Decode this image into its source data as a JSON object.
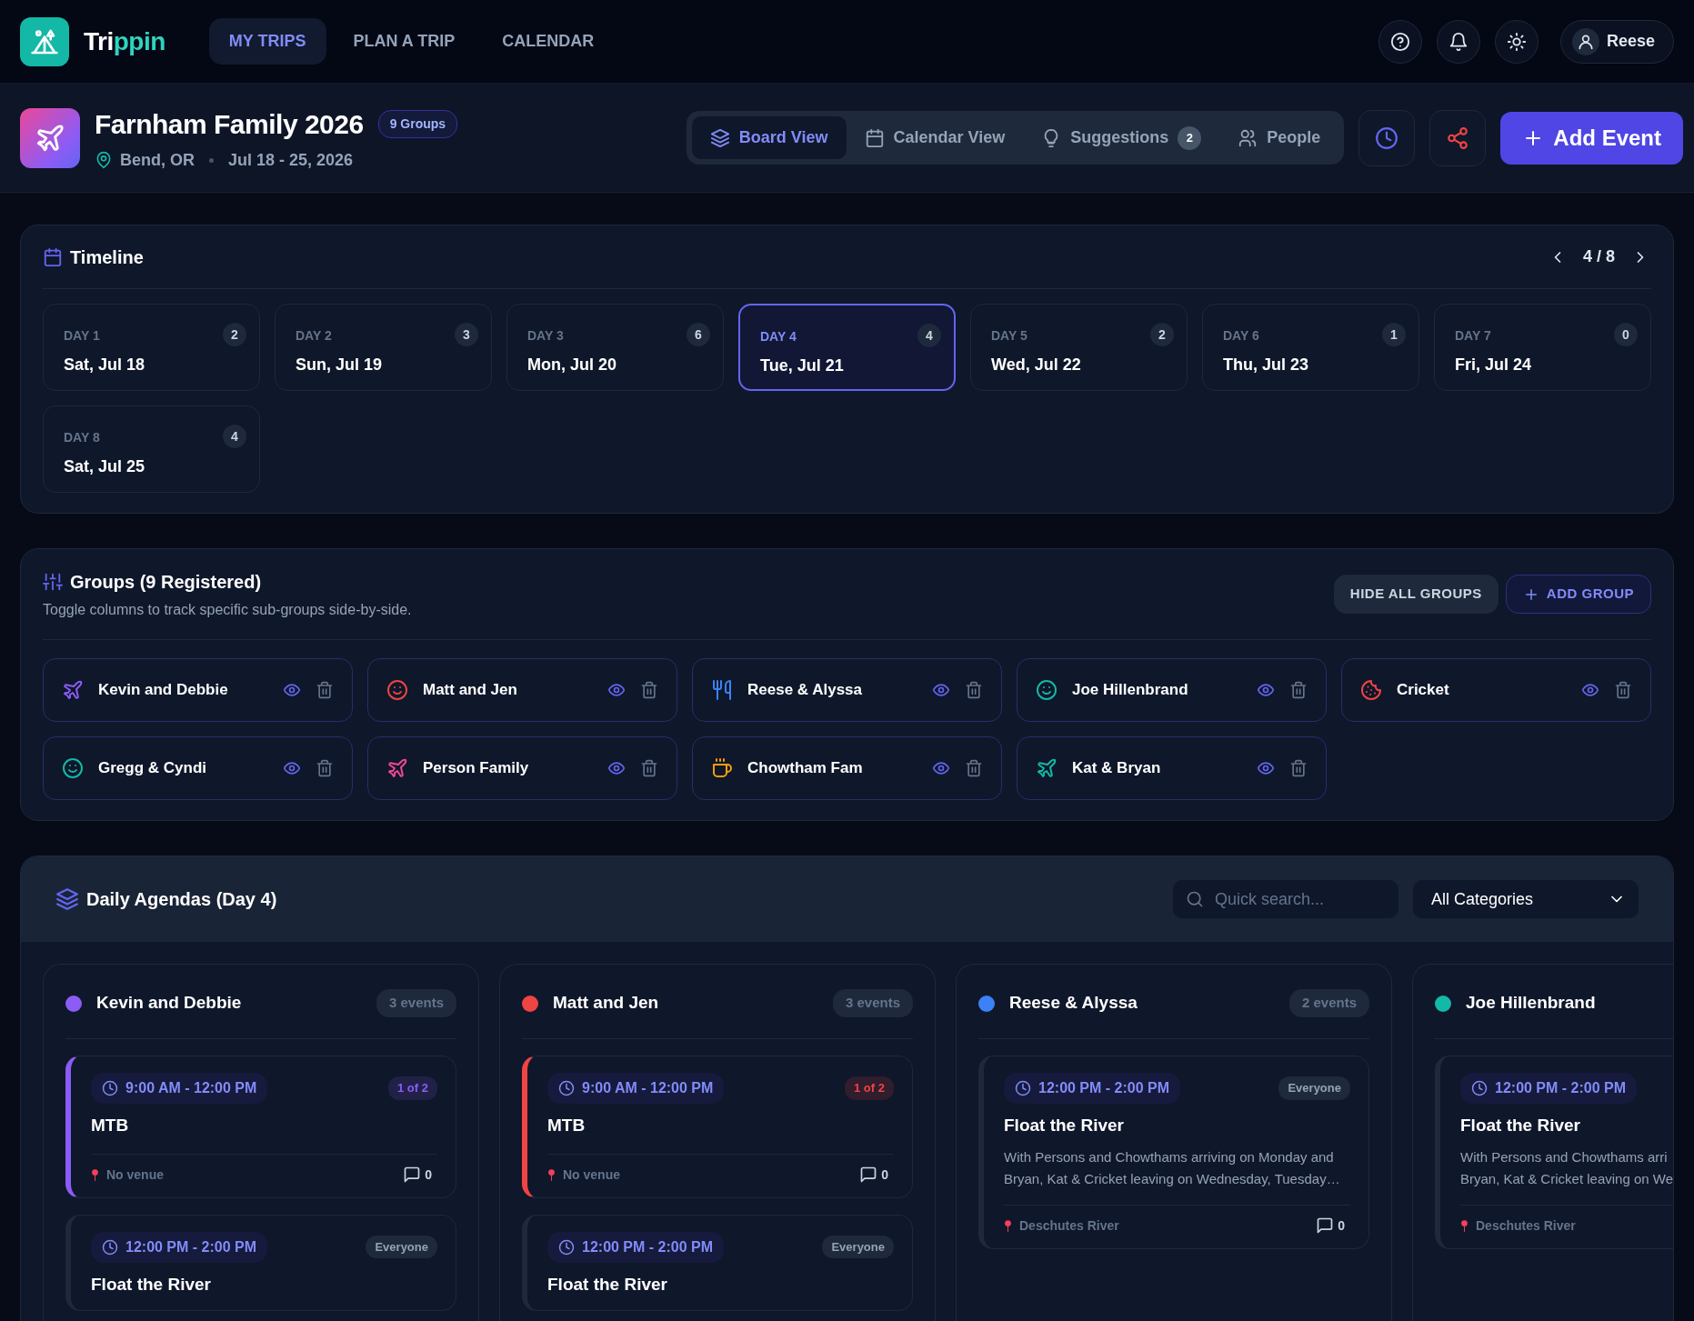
{
  "brand": {
    "lead": "Tri",
    "accent": "ppin"
  },
  "nav": [
    {
      "label": "MY TRIPS",
      "selected": true
    },
    {
      "label": "PLAN A TRIP",
      "selected": false
    },
    {
      "label": "CALENDAR",
      "selected": false
    }
  ],
  "user": {
    "name": "Reese"
  },
  "trip": {
    "title": "Farnham Family 2026",
    "badge": "9 Groups",
    "location": "Bend, OR",
    "dates": "Jul 18 - 25, 2026"
  },
  "view_tabs": [
    {
      "label": "Board View",
      "kind": "layers",
      "selected": true
    },
    {
      "label": "Calendar View",
      "kind": "calendar",
      "selected": false
    },
    {
      "label": "Suggestions",
      "kind": "bulb",
      "count": "2",
      "selected": false
    },
    {
      "label": "People",
      "kind": "people",
      "selected": false
    }
  ],
  "add_event": "Add Event",
  "timeline": {
    "title": "Timeline",
    "pager": "4 / 8",
    "days": [
      {
        "label": "DAY 1",
        "date": "Sat, Jul 18",
        "count": "2",
        "selected": false
      },
      {
        "label": "DAY 2",
        "date": "Sun, Jul 19",
        "count": "3",
        "selected": false
      },
      {
        "label": "DAY 3",
        "date": "Mon, Jul 20",
        "count": "6",
        "selected": false
      },
      {
        "label": "DAY 4",
        "date": "Tue, Jul 21",
        "count": "4",
        "selected": true
      },
      {
        "label": "DAY 5",
        "date": "Wed, Jul 22",
        "count": "2",
        "selected": false
      },
      {
        "label": "DAY 6",
        "date": "Thu, Jul 23",
        "count": "1",
        "selected": false
      },
      {
        "label": "DAY 7",
        "date": "Fri, Jul 24",
        "count": "0",
        "selected": false
      },
      {
        "label": "DAY 8",
        "date": "Sat, Jul 25",
        "count": "4",
        "selected": false
      }
    ]
  },
  "groups": {
    "title": "Groups (9 Registered)",
    "subtitle": "Toggle columns to track specific sub-groups side-by-side.",
    "hide_all": "HIDE ALL GROUPS",
    "add": "ADD GROUP",
    "items": [
      {
        "name": "Kevin and Debbie",
        "kind": "plane",
        "color": "#8b5cf6"
      },
      {
        "name": "Matt and Jen",
        "kind": "smile",
        "color": "#ef4444"
      },
      {
        "name": "Reese & Alyssa",
        "kind": "utensils",
        "color": "#3b82f6"
      },
      {
        "name": "Joe Hillenbrand",
        "kind": "smile",
        "color": "#14b8a6"
      },
      {
        "name": "Cricket",
        "kind": "cookie",
        "color": "#ef4444"
      },
      {
        "name": "Gregg & Cyndi",
        "kind": "smile",
        "color": "#14b8a6"
      },
      {
        "name": "Person Family",
        "kind": "plane",
        "color": "#ec4899"
      },
      {
        "name": "Chowtham Fam",
        "kind": "coffee",
        "color": "#f59e0b"
      },
      {
        "name": "Kat & Bryan",
        "kind": "plane",
        "color": "#14b8a6"
      }
    ]
  },
  "agenda": {
    "title": "Daily Agendas (Day 4)",
    "search": {
      "placeholder": "Quick search..."
    },
    "category": "All Categories",
    "columns": [
      {
        "name": "Kevin and Debbie",
        "color": "#8b5cf6",
        "count": "3 events",
        "events": [
          {
            "kind": "group",
            "time": "9:00 AM - 12:00 PM",
            "tag": "1 of 2",
            "title": "MTB",
            "venue": "No venue",
            "comments": "0"
          },
          {
            "kind": "shared",
            "time": "12:00 PM - 2:00 PM",
            "tag": "Everyone",
            "title": "Float the River"
          }
        ]
      },
      {
        "name": "Matt and Jen",
        "color": "#ef4444",
        "count": "3 events",
        "events": [
          {
            "kind": "group",
            "time": "9:00 AM - 12:00 PM",
            "tag": "1 of 2",
            "title": "MTB",
            "venue": "No venue",
            "comments": "0"
          },
          {
            "kind": "shared",
            "time": "12:00 PM - 2:00 PM",
            "tag": "Everyone",
            "title": "Float the River"
          }
        ]
      },
      {
        "name": "Reese & Alyssa",
        "color": "#3b82f6",
        "count": "2 events",
        "events": [
          {
            "kind": "shared",
            "time": "12:00 PM - 2:00 PM",
            "tag": "Everyone",
            "title": "Float the River",
            "description": [
              "With Persons and Chowthams arriving on Monday and",
              "Bryan, Kat & Cricket leaving on Wednesday, Tuesday…"
            ],
            "venue": "Deschutes River",
            "comments": "0"
          }
        ]
      },
      {
        "name": "Joe Hillenbrand",
        "color": "#14b8a6",
        "events": [
          {
            "kind": "shared",
            "time": "12:00 PM - 2:00 PM",
            "title": "Float the River",
            "description": [
              "With Persons and Chowthams arri",
              "Bryan, Kat & Cricket leaving on We"
            ],
            "venue": "Deschutes River"
          }
        ]
      }
    ]
  }
}
